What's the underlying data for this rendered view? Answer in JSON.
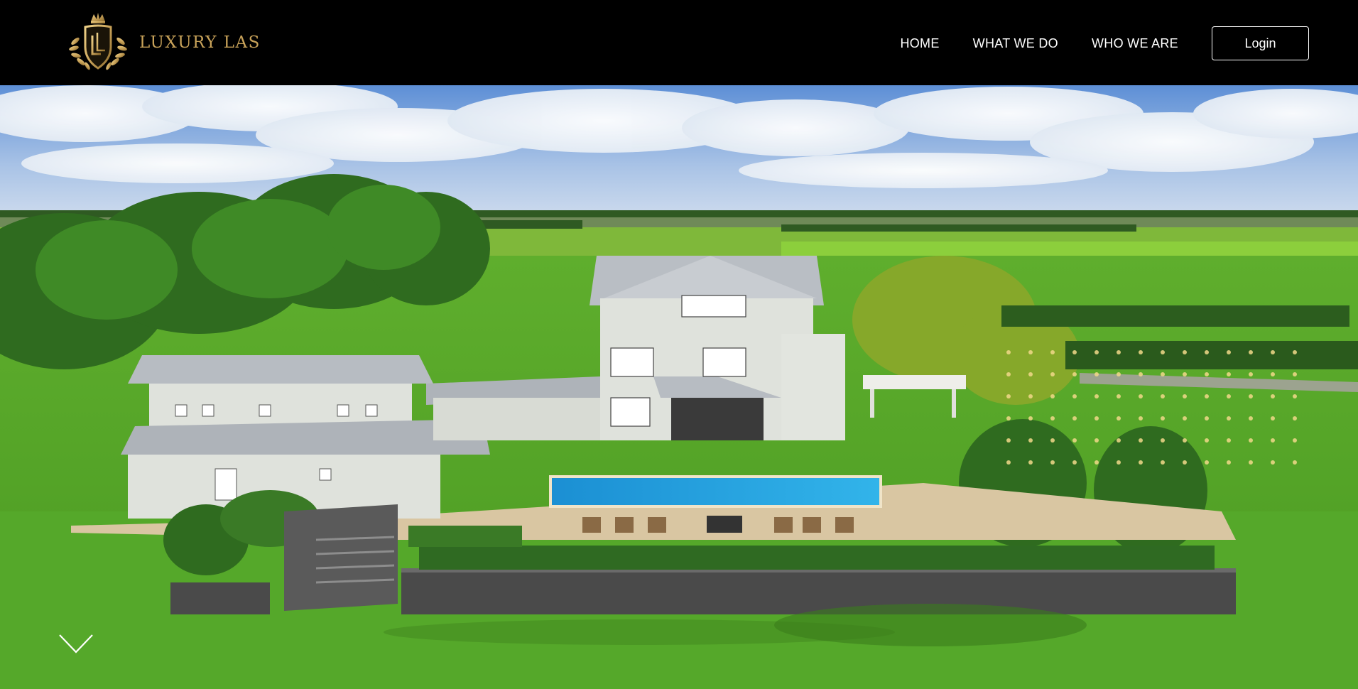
{
  "brand": {
    "name": "LUXURY LAS",
    "logo_monogram": "LL",
    "logo_icon": "crest-crown-icon",
    "accent_color": "#c9a35a"
  },
  "nav": {
    "items": [
      {
        "label": "HOME"
      },
      {
        "label": "WHAT WE DO"
      },
      {
        "label": "WHO WE ARE"
      }
    ],
    "login_label": "Login"
  },
  "hero": {
    "image_subject": "aerial-estate-mansion-with-pool",
    "scroll_icon": "chevron-down-icon"
  },
  "colors": {
    "header_bg": "#000000",
    "nav_text": "#ffffff",
    "gold": "#c9a35a",
    "lawn": "#4fa82a",
    "pool": "#1fa4e0"
  }
}
